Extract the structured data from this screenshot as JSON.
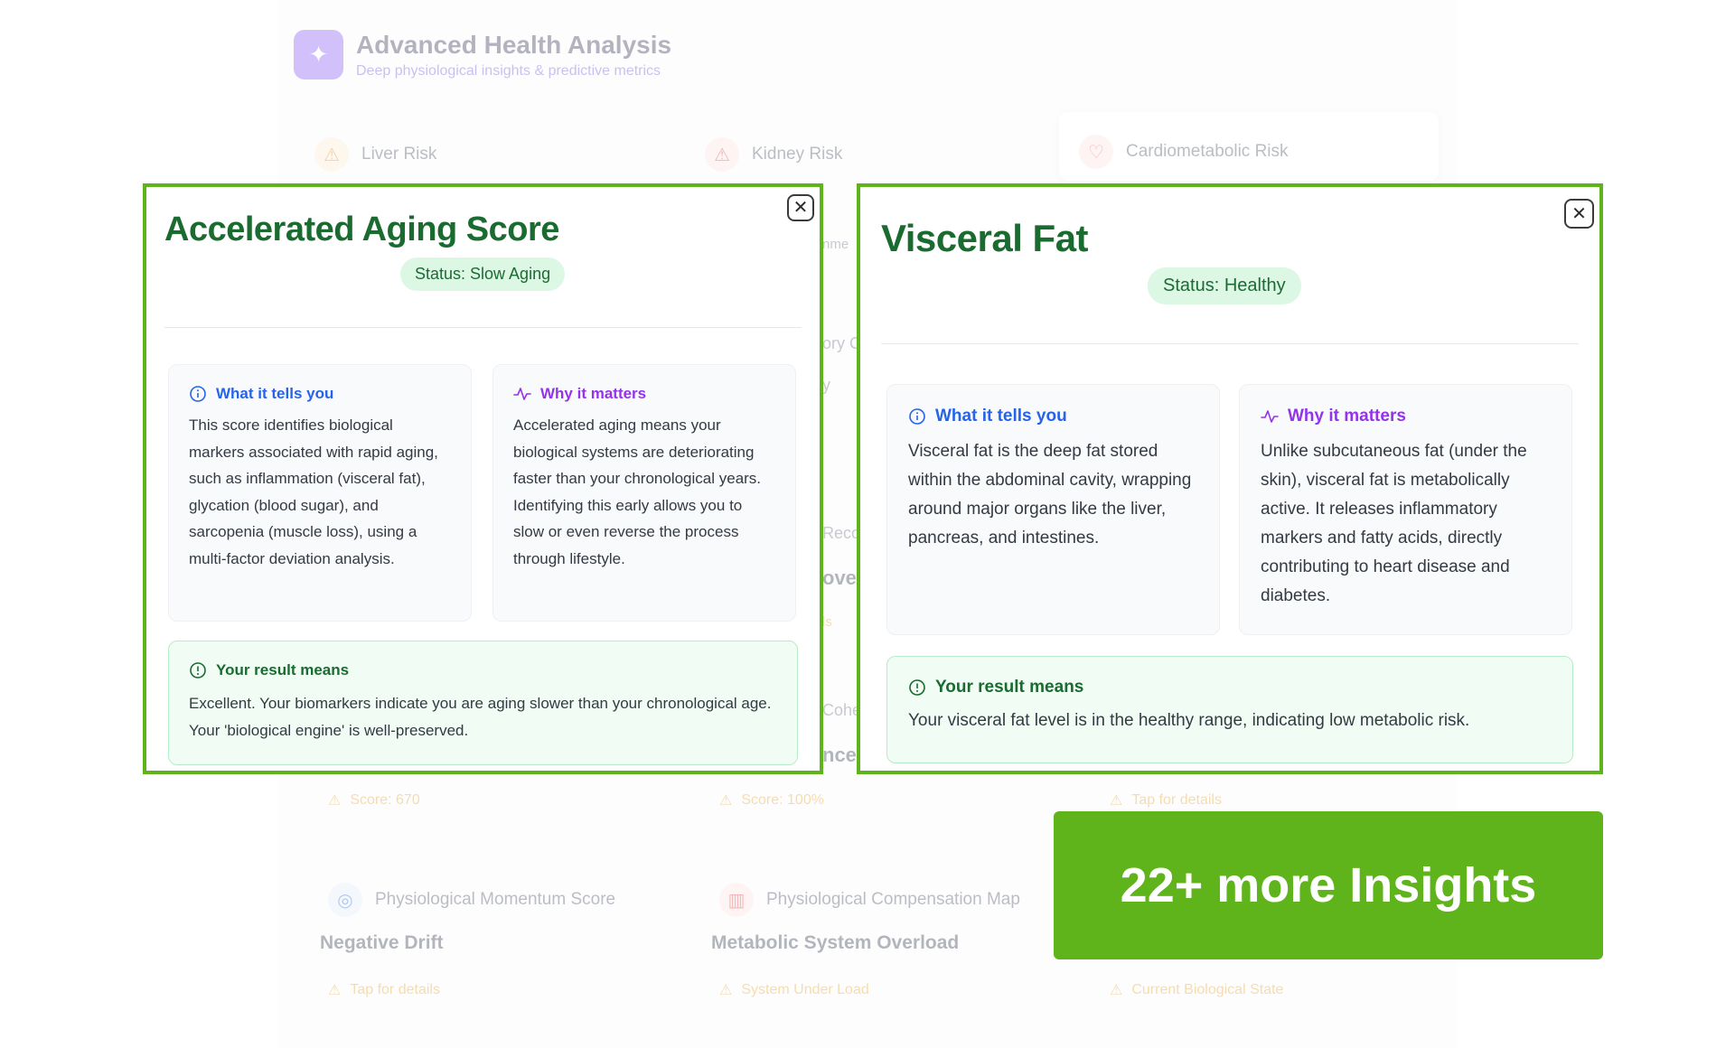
{
  "background": {
    "app_title": "Advanced Health Analysis",
    "app_subtitle": "Deep physiological insights & predictive metrics",
    "cards": {
      "liver": "Liver Risk",
      "kidney": "Kidney Risk",
      "cardiometabolic": "Cardiometabolic Risk",
      "momentum": "Physiological Momentum Score",
      "compensation": "Physiological Compensation Map"
    },
    "values": {
      "momentum": "Negative Drift",
      "compensation": "Metabolic System Overload"
    },
    "notes": {
      "score_670": "Score: 670",
      "score_100": "Score: 100%",
      "tap_details_1": "Tap for details",
      "tap_details_2": "Tap for details",
      "system_under_load": "System Under Load",
      "current_state": "Current Biological State"
    },
    "fragments": {
      "f1": "nme",
      "f2": "ory C",
      "f3": "y",
      "f4": "Reco",
      "f5": "ove",
      "f6": "ls",
      "f7": "Cohe",
      "f8": "nce"
    }
  },
  "modal_aging": {
    "title": "Accelerated Aging Score",
    "status": "Status: Slow Aging",
    "what_heading": "What it tells you",
    "what_text": "This score identifies biological markers associated with rapid aging, such as inflammation (visceral fat), glycation (blood sugar), and sarcopenia (muscle loss), using a multi-factor deviation analysis.",
    "why_heading": "Why it matters",
    "why_text": "Accelerated aging means your biological systems are deteriorating faster than your chronological years. Identifying this early allows you to slow or even reverse the process through lifestyle.",
    "result_heading": "Your result means",
    "result_text": "Excellent. Your biomarkers indicate you are aging slower than your chronological age. Your 'biological engine' is well-preserved."
  },
  "modal_visceral": {
    "title": "Visceral Fat",
    "status": "Status: Healthy",
    "what_heading": "What it tells you",
    "what_text": "Visceral fat is the deep fat stored within the abdominal cavity, wrapping around major organs like the liver, pancreas, and intestines.",
    "why_heading": "Why it matters",
    "why_text": "Unlike subcutaneous fat (under the skin), visceral fat is metabolically active. It releases inflammatory markers and fatty acids, directly contributing to heart disease and diabetes.",
    "result_heading": "Your result means",
    "result_text": "Your visceral fat level is in the healthy range, indicating low metabolic risk."
  },
  "cta": {
    "label": "22+ more Insights"
  },
  "colors": {
    "accent_green": "#5fb31b",
    "title_green": "#196b2f",
    "info_blue": "#2563eb",
    "why_purple": "#9333ea"
  }
}
